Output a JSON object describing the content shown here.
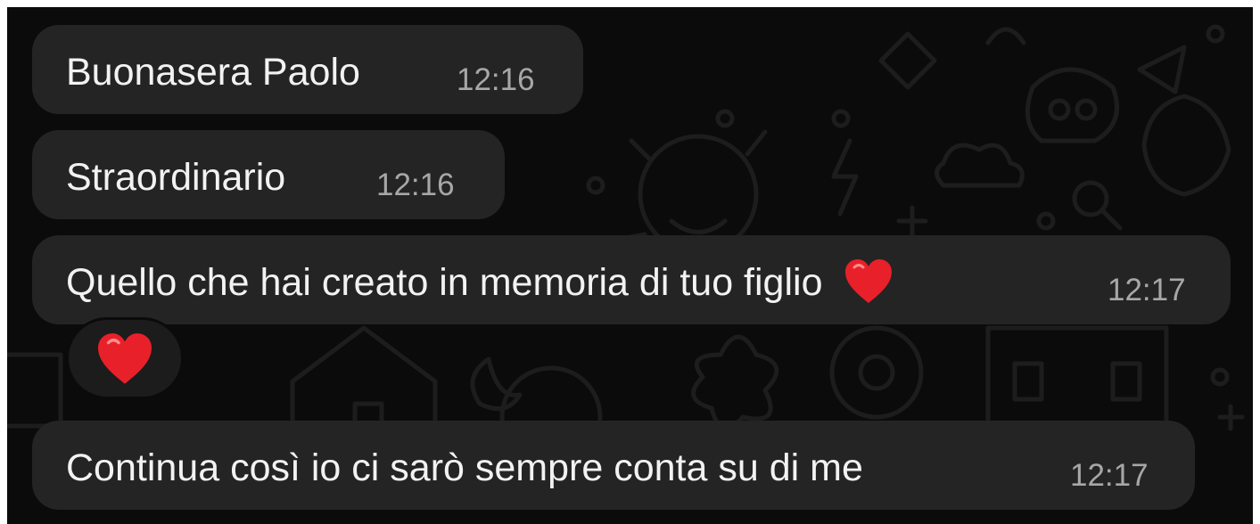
{
  "messages": [
    {
      "text": "Buonasera Paolo",
      "time": "12:16"
    },
    {
      "text": "Straordinario",
      "time": "12:16"
    },
    {
      "text": "Quello che hai creato in memoria di tuo figlio",
      "emoji": "red-heart",
      "time": "12:17"
    },
    {
      "text": "Continua così io ci sarò sempre conta su di me",
      "time": "12:17"
    }
  ],
  "reaction": {
    "emoji": "red-heart"
  },
  "colors": {
    "background": "#0b0b0b",
    "bubble": "#242424",
    "text": "#f2f2f2",
    "timestamp": "#a7a7a7",
    "heart": "#e8202a"
  }
}
